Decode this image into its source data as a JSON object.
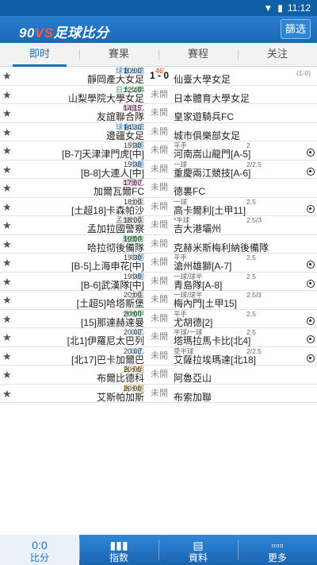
{
  "status": {
    "time": "11:12"
  },
  "app": {
    "logo_num": "90",
    "logo_vs": "VS",
    "logo_text": "足球比分",
    "filter_label": "篩选"
  },
  "tabs": [
    {
      "label": "即时",
      "active": true
    },
    {
      "label": "賽果",
      "active": false
    },
    {
      "label": "賽程",
      "active": false
    },
    {
      "label": "关注",
      "active": false
    }
  ],
  "colors": {
    "accent": "#1e6fbf",
    "live": "#e03a00"
  },
  "matches": [
    {
      "league": "球會友誼",
      "league_color": "#2a7fc8",
      "time": "10:00",
      "live": "46'",
      "home": "靜岡產大女足",
      "mid": "1 - 0",
      "is_score": true,
      "hc": "",
      "hc2": "",
      "away": "仙臺大學女足",
      "ht": "(1-0)",
      "ball": false
    },
    {
      "league": "日大女錦",
      "league_color": "#1a9a3a",
      "time": "12:40",
      "live": "",
      "home": "山梨學院大學女足",
      "mid": "未開",
      "is_score": false,
      "hc": "",
      "hc2": "",
      "away": "日本體育大學女足",
      "ht": "",
      "ball": false
    },
    {
      "league": "印度乙",
      "league_color": "#b0389e",
      "time": "14:15",
      "live": "",
      "home": "友誼聯合隊",
      "mid": "未開",
      "is_score": false,
      "hc": "",
      "hc2": "",
      "away": "皇家遊騎兵FC",
      "ht": "",
      "ball": false
    },
    {
      "league": "球會友誼",
      "league_color": "#2a7fc8",
      "time": "14:30",
      "live": "",
      "home": "邊疆女足",
      "mid": "未開",
      "is_score": false,
      "hc": "",
      "hc2": "",
      "away": "城市俱樂部女足",
      "ht": "",
      "ball": false
    },
    {
      "league": "中超",
      "league_color": "#2a7fc8",
      "time": "15:30",
      "live": "",
      "home": "[B-7]天津津門虎[中]",
      "mid": "未開",
      "is_score": false,
      "hc": "平手",
      "hc2": "2",
      "away": "河南嵩山龍門[A-5]",
      "ht": "",
      "ball": true
    },
    {
      "league": "中超",
      "league_color": "#2a7fc8",
      "time": "15:30",
      "live": "",
      "home": "[B-8]大連人[中]",
      "mid": "未開",
      "is_score": false,
      "hc": "一球",
      "hc2": "2/2.5",
      "away": "重慶兩江競技[A-6]",
      "ht": "",
      "ball": true
    },
    {
      "league": "印度乙",
      "league_color": "#b0389e",
      "time": "17:00",
      "live": "",
      "home": "加爾瓦爾FC",
      "mid": "未開",
      "is_score": false,
      "hc": "",
      "hc2": "",
      "away": "德裏FC",
      "ht": "",
      "ball": false
    },
    {
      "league": "土盃",
      "league_color": "#777777",
      "time": "18:00",
      "live": "",
      "home": "[土超18]卡森帕沙",
      "mid": "未開",
      "is_score": false,
      "hc": "一球",
      "hc2": "2.5",
      "away": "高卡爾利[土甲11]",
      "ht": "",
      "ball": true
    },
    {
      "league": "孟加拉盃",
      "league_color": "#777777",
      "time": "18:00",
      "live": "",
      "home": "孟加拉國警察",
      "mid": "未開",
      "is_score": false,
      "hc": "*半球",
      "hc2": "2.5/3",
      "away": "吉大港壩州",
      "ht": "",
      "ball": false
    },
    {
      "league": "阿爾青",
      "league_color": "#1a9a3a",
      "time": "19:00",
      "live": "",
      "home": "哈拉彻後備隊",
      "mid": "未開",
      "is_score": false,
      "hc": "",
      "hc2": "",
      "away": "克赫米斯梅利納後備隊",
      "ht": "",
      "ball": false
    },
    {
      "league": "中超",
      "league_color": "#2a7fc8",
      "time": "19:30",
      "live": "",
      "home": "[B-5]上海申花[中]",
      "mid": "未開",
      "is_score": false,
      "hc": "平手",
      "hc2": "2.5",
      "away": "滄州雄獅[A-7]",
      "ht": "",
      "ball": true
    },
    {
      "league": "中超",
      "league_color": "#2a7fc8",
      "time": "19:30",
      "live": "",
      "home": "[B-6]武漢隊[中]",
      "mid": "未開",
      "is_score": false,
      "hc": "一球/球半",
      "hc2": "2.5",
      "away": "青島隊[A-8]",
      "ht": "",
      "ball": true
    },
    {
      "league": "土盃",
      "league_color": "#777777",
      "time": "20:00",
      "live": "",
      "home": "[土超5]哈塔斯堡",
      "mid": "未開",
      "is_score": false,
      "hc": "一球/球半",
      "hc2": "2.5/3",
      "away": "梅內門[土甲15]",
      "ht": "",
      "ball": false
    },
    {
      "league": "沙地甲",
      "league_color": "#1a9a3a",
      "time": "20:00",
      "live": "",
      "home": "[15]那達赫達曼",
      "mid": "未開",
      "is_score": false,
      "hc": "平手",
      "hc2": "2.5",
      "away": "尤胡德[2]",
      "ht": "",
      "ball": true
    },
    {
      "league": "以乙",
      "league_color": "#2a7fc8",
      "time": "20:00",
      "live": "",
      "home": "[北1]伊羅尼太巴列",
      "mid": "未開",
      "is_score": false,
      "hc": "半球/一球",
      "hc2": "2.5",
      "away": "塔瑪拉馬卡比[北4]",
      "ht": "",
      "ball": true
    },
    {
      "league": "以乙",
      "league_color": "#2a7fc8",
      "time": "20:00",
      "live": "",
      "home": "[北17]巴卡加爾巴",
      "mid": "未開",
      "is_score": false,
      "hc": "受半球",
      "hc2": "2/2.5",
      "away": "艾薩拉埃瑪達[北18]",
      "ht": "",
      "ball": true
    },
    {
      "league": "烏干超",
      "league_color": "#b07a00",
      "time": "20:00",
      "live": "",
      "home": "布爾比德科",
      "mid": "未開",
      "is_score": false,
      "hc": "",
      "hc2": "",
      "away": "阿魯亞山",
      "ht": "",
      "ball": false
    },
    {
      "league": "烏干超",
      "league_color": "#b07a00",
      "time": "20:00",
      "live": "",
      "home": "艾斯帕加斯",
      "mid": "未開",
      "is_score": false,
      "hc": "",
      "hc2": "",
      "away": "布索加聯",
      "ht": "",
      "ball": false
    }
  ],
  "bottom_tabs": [
    {
      "label": "比分",
      "icon": "score-icon",
      "glyph": "0:0",
      "active": true
    },
    {
      "label": "指数",
      "icon": "index-chart-icon",
      "glyph": "▮▮▮",
      "active": false
    },
    {
      "label": "資料",
      "icon": "document-icon",
      "glyph": "▤",
      "active": false
    },
    {
      "label": "更多",
      "icon": "more-icon",
      "glyph": "▫▫▫",
      "active": false
    }
  ]
}
